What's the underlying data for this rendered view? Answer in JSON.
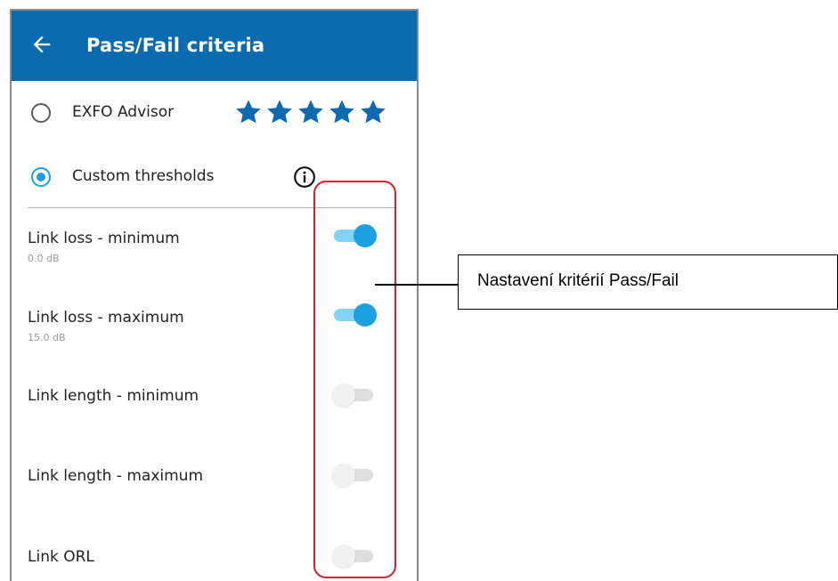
{
  "appbar": {
    "back_icon": "arrow-left-icon",
    "title": "Pass/Fail criteria",
    "color": "#0a6bb1"
  },
  "options": [
    {
      "label": "EXFO Advisor",
      "selected": false,
      "rating_stars": 5,
      "star_color": "#0a6bb1"
    },
    {
      "label": "Custom thresholds",
      "selected": true,
      "info_icon": "info-icon"
    }
  ],
  "settings": [
    {
      "label": "Link loss - minimum",
      "value": "0.0 dB",
      "enabled": true
    },
    {
      "label": "Link loss - maximum",
      "value": "15.0 dB",
      "enabled": true
    },
    {
      "label": "Link length - minimum",
      "enabled": false
    },
    {
      "label": "Link length - maximum",
      "enabled": false
    },
    {
      "label": "Link ORL",
      "enabled": false
    }
  ],
  "annotation": {
    "callout_text": "Nastavení kritérií Pass/Fail",
    "highlight_color": "#e0182e"
  },
  "colors": {
    "toggle_on_thumb": "#1ba1e2",
    "toggle_on_track": "#80d4f5"
  }
}
